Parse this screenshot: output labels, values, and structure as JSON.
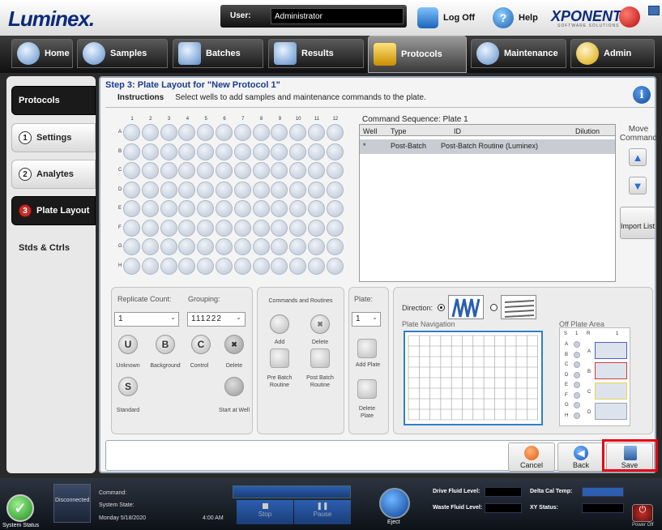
{
  "header": {
    "logo": "Luminex.",
    "user_label": "User:",
    "user_value": "Administrator",
    "logoff_label": "Log Off",
    "help_label": "Help",
    "brand": "XPONENT.",
    "brand_sub": "SOFTWARE SOLUTIONS"
  },
  "nav": {
    "tabs": [
      {
        "label": "Home"
      },
      {
        "label": "Samples"
      },
      {
        "label": "Batches"
      },
      {
        "label": "Results"
      },
      {
        "label": "Protocols"
      },
      {
        "label": "Maintenance"
      },
      {
        "label": "Admin"
      }
    ]
  },
  "sidebar": {
    "items": [
      {
        "label": "Protocols"
      },
      {
        "num": "1",
        "label": "Settings"
      },
      {
        "num": "2",
        "label": "Analytes"
      },
      {
        "num": "3",
        "label": "Plate Layout"
      },
      {
        "label": "Stds & Ctrls"
      }
    ]
  },
  "step": {
    "title": "Step 3: Plate Layout for \"New Protocol 1\"",
    "instructions_label": "Instructions",
    "instructions_text": "Select wells to add samples and maintenance commands to the plate."
  },
  "plate": {
    "columns": [
      "1",
      "2",
      "3",
      "4",
      "5",
      "6",
      "7",
      "8",
      "9",
      "10",
      "11",
      "12"
    ],
    "rows": [
      "A",
      "B",
      "C",
      "D",
      "E",
      "F",
      "G",
      "H"
    ]
  },
  "command_sequence": {
    "label": "Command Sequence: Plate 1",
    "headers": [
      "Well",
      "Type",
      "ID",
      "Dilution"
    ],
    "rows": [
      {
        "well": "*",
        "type": "Post-Batch",
        "id": "Post-Batch Routine (Luminex)",
        "dilution": ""
      }
    ]
  },
  "move": {
    "label": "Move Command",
    "import_label": "Import List"
  },
  "replicate": {
    "count_label": "Replicate Count:",
    "count_value": "1",
    "grouping_label": "Grouping:",
    "grouping_value": "111222"
  },
  "sample_types": {
    "unknown": "Unknown",
    "background": "Background",
    "control": "Control",
    "delete": "Delete",
    "standard": "Standard",
    "start_at_well": "Start at Well"
  },
  "commands": {
    "label": "Commands and Routines",
    "add": "Add",
    "delete": "Delete",
    "pre_batch": "Pre Batch Routine",
    "post_batch": "Post Batch Routine"
  },
  "plate_panel": {
    "label": "Plate:",
    "value": "1",
    "add_plate": "Add Plate",
    "delete_plate": "Delete Plate"
  },
  "direction": {
    "label": "Direction:",
    "plate_navigation": "Plate Navigation",
    "off_plate_area": "Off Plate Area",
    "off_cols": [
      "S",
      "1",
      "R",
      "1"
    ],
    "off_rows": [
      "A",
      "B",
      "C",
      "D",
      "E",
      "F",
      "G",
      "H"
    ],
    "off_blocks": [
      "A",
      "B",
      "C",
      "D"
    ]
  },
  "footer_buttons": {
    "cancel": "Cancel",
    "back": "Back",
    "save": "Save"
  },
  "status": {
    "system_status": "System Status",
    "disconnected": "Disconnected",
    "command": "Command:",
    "system_state": "System State:",
    "date": "Monday 5/18/2020",
    "time": "4:00 AM",
    "stop": "Stop",
    "pause": "Pause",
    "eject": "Eject",
    "drive_fluid": "Drive Fluid Level:",
    "waste_fluid": "Waste Fluid Level:",
    "delta_cal": "Delta Cal Temp:",
    "xy_status": "XY Status:",
    "power_off": "Power Off"
  },
  "colors": {
    "accent": "#1a3d8a",
    "save_highlight": "#e60012"
  }
}
